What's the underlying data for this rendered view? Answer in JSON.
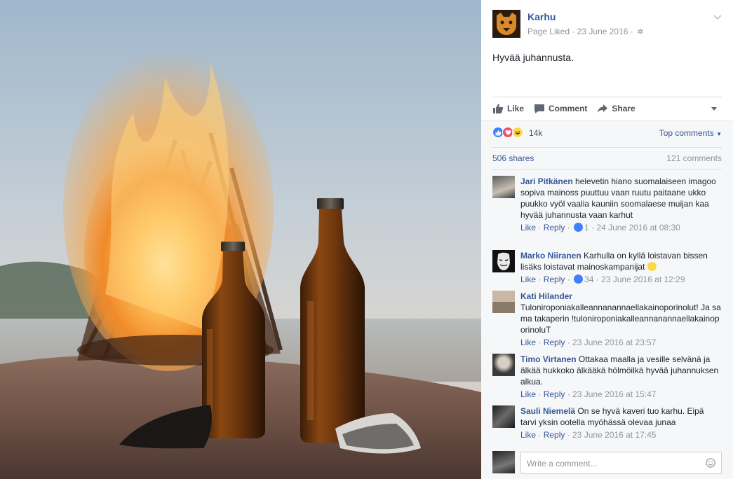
{
  "post": {
    "page_name": "Karhu",
    "meta": "Page Liked · 23 June 2016 · ",
    "text": "Hyvää juhannusta."
  },
  "actions": {
    "like": "Like",
    "comment": "Comment",
    "share": "Share"
  },
  "reactions": {
    "count": "14k",
    "top_comments": "Top comments",
    "shares": "506 shares",
    "comments": "121 comments"
  },
  "comments": [
    {
      "author": "Jari Pitkänen",
      "text": "helevetin hiano suomalaiseen imagoo sopiva mainoss puuttuu vaan ruutu paitaane ukko puukko vyöl vaalia kauniin soomalaese muijan kaa hyvää juhannusta vaan karhut",
      "like": "Like",
      "reply": "Reply",
      "likes": "1",
      "time": "24 June 2016 at 08:30"
    },
    {
      "author": "Marko Niiranen",
      "text": "Karhulla on kyllä loistavan bissen lisäks loistavat mainoskampanijat",
      "like": "Like",
      "reply": "Reply",
      "likes": "34",
      "time": "23 June 2016 at 12:29"
    },
    {
      "author": "Kati Hilander",
      "text": "Tuloniroponiakalleannanannaellakainoporinolut! Ja sama takaperin !tuloniroponiakalleannanannaellakainoporinoluT",
      "like": "Like",
      "reply": "Reply",
      "time": "23 June 2016 at 23:57"
    },
    {
      "author": "Timo Virtanen",
      "text": "Ottakaa maalla ja vesille selvänä ja älkää hukkoko älkääkä hölmöilkä hyvää juhannuksen alkua.",
      "like": "Like",
      "reply": "Reply",
      "time": "23 June 2016 at 15:47"
    },
    {
      "author": "Sauli Niemelä",
      "text": "On se hyvä kaveri tuo karhu. Eipä tarvi yksin ootella myöhässä olevaa junaa",
      "like": "Like",
      "reply": "Reply",
      "time": "23 June 2016 at 17:45"
    }
  ],
  "composer": {
    "placeholder": "Write a comment..."
  },
  "colors": {
    "link": "#365899",
    "muted": "#90949c",
    "like_blue": "#4080ff",
    "love_red": "#f25268",
    "haha_yellow": "#fcd94a"
  }
}
